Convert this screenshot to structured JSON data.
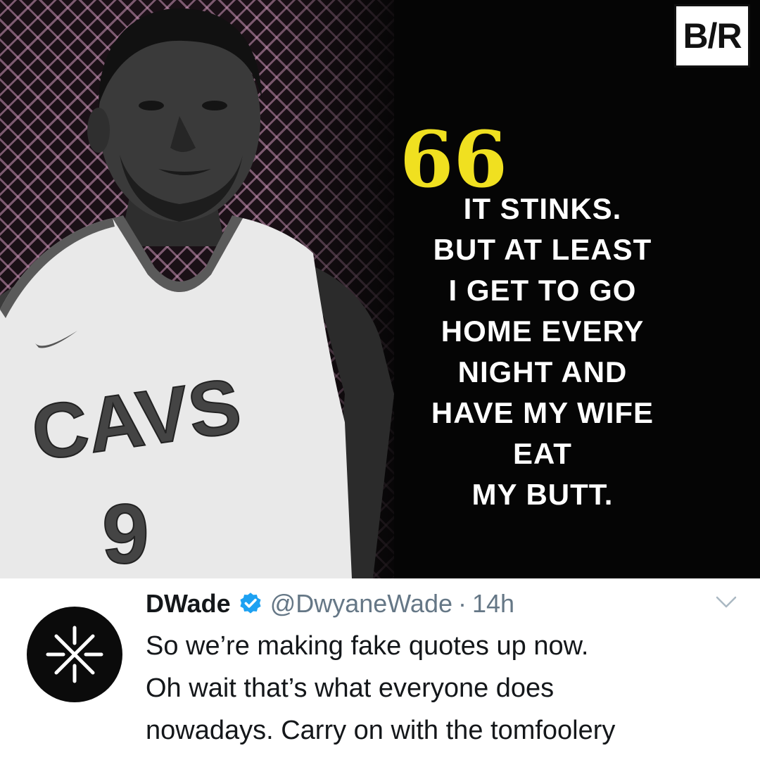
{
  "quote_image": {
    "logo_text": "B/R",
    "quote_mark": "66",
    "quote_lines": [
      "IT STINKS.",
      "BUT AT LEAST",
      "I GET TO GO",
      "HOME EVERY",
      "NIGHT AND",
      "HAVE MY WIFE",
      "EAT",
      "MY BUTT."
    ],
    "jersey_team": "CAVS",
    "jersey_number": "9",
    "colors": {
      "background": "#050505",
      "pattern": "#cd96b9",
      "quote_mark": "#f0e020",
      "text": "#ffffff"
    }
  },
  "tweet": {
    "display_name": "DWade",
    "verified_icon": "verified-badge-icon",
    "handle": "@DwyaneWade",
    "separator": "·",
    "timestamp": "14h",
    "menu_icon": "chevron-down-icon",
    "text_lines": [
      "So we’re making fake quotes up now.",
      "Oh wait that’s what everyone does",
      "nowadays. Carry on with the tomfoolery"
    ],
    "colors": {
      "name": "#14171a",
      "muted": "#657786",
      "verified": "#1da1f2",
      "avatar_bg": "#0b0b0b"
    }
  }
}
